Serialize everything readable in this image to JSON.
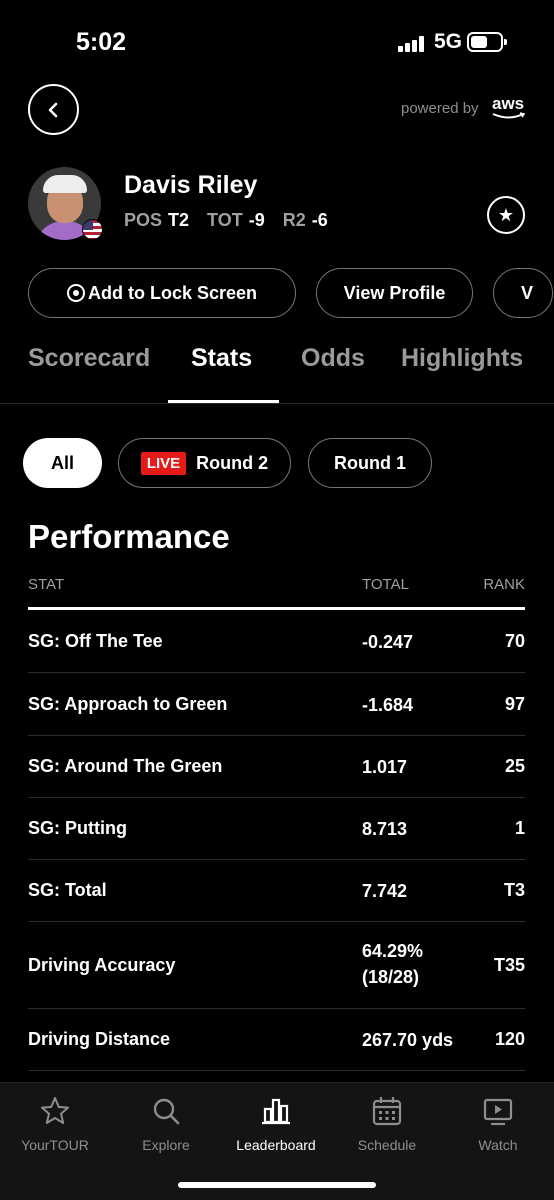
{
  "status_bar": {
    "time": "5:02",
    "network": "5G"
  },
  "header": {
    "powered_by": "powered by",
    "brand": "aws"
  },
  "player": {
    "name": "Davis Riley",
    "pos_label": "POS",
    "pos_value": "T2",
    "tot_label": "TOT",
    "tot_value": "-9",
    "round_label": "R2",
    "round_value": "-6"
  },
  "actions": {
    "lock_screen": "Add to Lock Screen",
    "view_profile": "View Profile",
    "more": "V"
  },
  "tabs": [
    {
      "label": "Scorecard"
    },
    {
      "label": "Stats"
    },
    {
      "label": "Odds"
    },
    {
      "label": "Highlights"
    }
  ],
  "filters": {
    "all": "All",
    "live_badge": "LIVE",
    "round2": "Round 2",
    "round1": "Round 1"
  },
  "performance": {
    "title": "Performance",
    "columns": {
      "stat": "STAT",
      "total": "TOTAL",
      "rank": "RANK"
    },
    "rows": [
      {
        "stat": "SG: Off The Tee",
        "total": "-0.247",
        "rank": "70"
      },
      {
        "stat": "SG: Approach to Green",
        "total": "-1.684",
        "rank": "97"
      },
      {
        "stat": "SG: Around The Green",
        "total": "1.017",
        "rank": "25"
      },
      {
        "stat": "SG: Putting",
        "total": "8.713",
        "rank": "1"
      },
      {
        "stat": "SG: Total",
        "total": "7.742",
        "rank": "T3"
      },
      {
        "stat": "Driving Accuracy",
        "total": "64.29%",
        "total_sub": "(18/28)",
        "rank": "T35"
      },
      {
        "stat": "Driving Distance",
        "total": "267.70 yds",
        "rank": "120"
      }
    ]
  },
  "bottom_nav": [
    {
      "label": "YourTOUR",
      "icon": "star-icon"
    },
    {
      "label": "Explore",
      "icon": "search-icon"
    },
    {
      "label": "Leaderboard",
      "icon": "bar-chart-icon"
    },
    {
      "label": "Schedule",
      "icon": "calendar-icon"
    },
    {
      "label": "Watch",
      "icon": "play-icon"
    }
  ]
}
